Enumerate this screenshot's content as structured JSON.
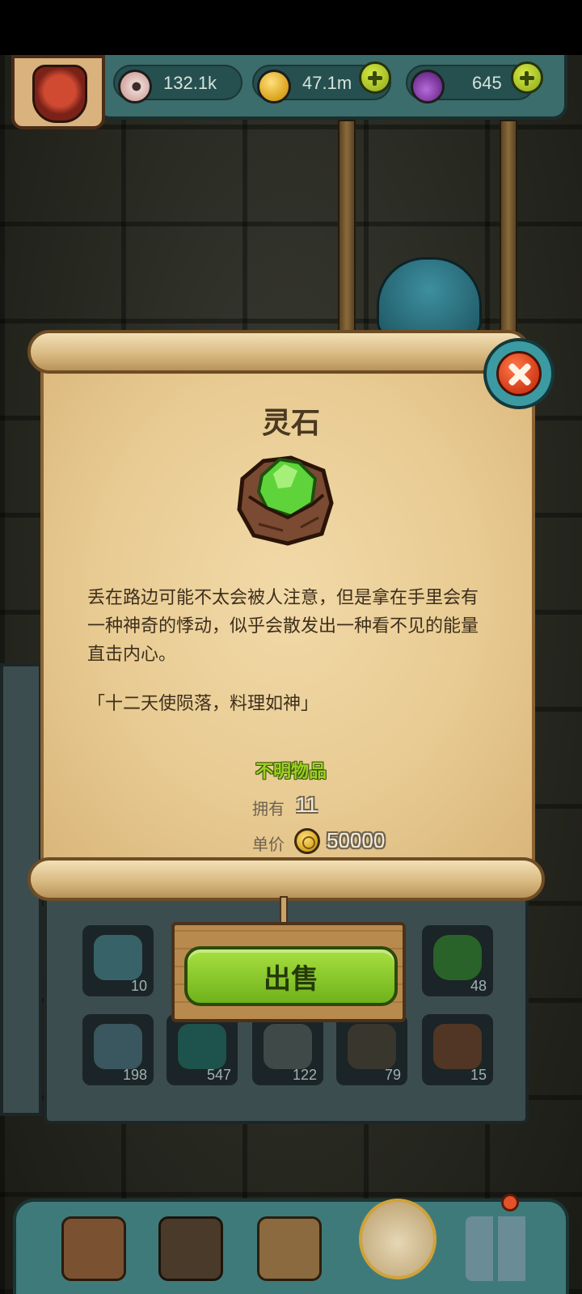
{
  "resources": {
    "eyes": "132.1k",
    "coins": "47.1m",
    "potions": "645"
  },
  "item": {
    "name": "灵石",
    "description": "丢在路边可能不太会被人注意，但是拿在手里会有一种神奇的悸动，似乎会散发出一种看不见的能量直击内心。",
    "quote": "「十二天使陨落，料理如神」",
    "rarity": "不明物品",
    "owned_label": "拥有",
    "owned_value": "11",
    "price_label": "单价",
    "price_value": "50000"
  },
  "sell_button": {
    "label": "出售"
  },
  "inventory": {
    "row1_counts": [
      "10",
      "48"
    ],
    "row2_counts": [
      "198",
      "547",
      "122",
      "79",
      "15"
    ]
  },
  "icons": {
    "eye": "eyeball-icon",
    "coin": "coin-icon",
    "potion": "potion-icon",
    "close": "close-icon"
  },
  "colors": {
    "rarity": "#9cd11e",
    "sell_button": "#8cc92a",
    "close_button": "#d23a18"
  }
}
